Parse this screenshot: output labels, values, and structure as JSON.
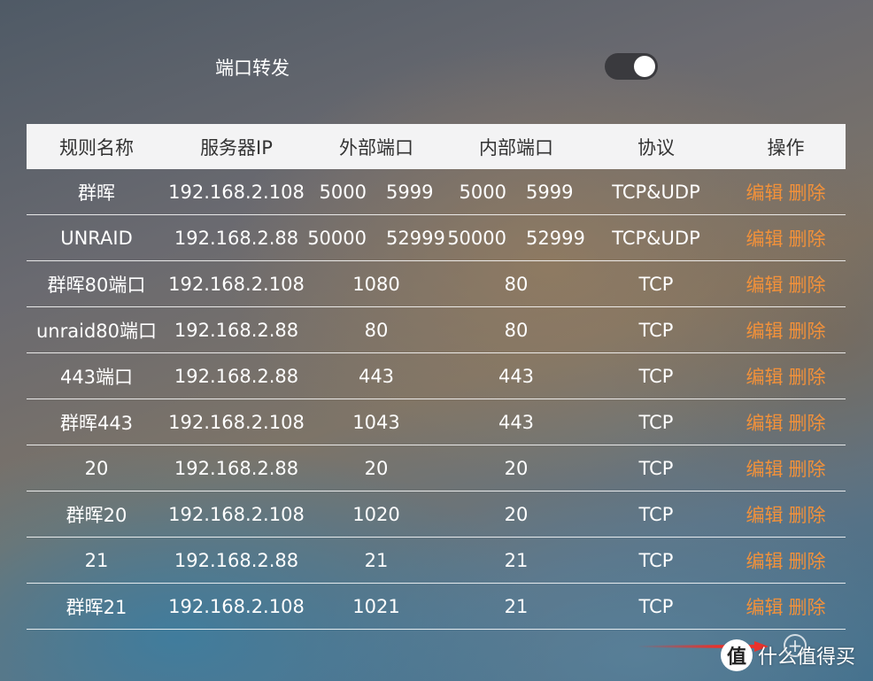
{
  "header": {
    "title": "端口转发",
    "toggle_on": true
  },
  "table": {
    "columns": [
      "规则名称",
      "服务器IP",
      "外部端口",
      "内部端口",
      "协议",
      "操作"
    ],
    "rows": [
      {
        "name": "群晖",
        "ip": "192.168.2.108",
        "ext_start": "5000",
        "ext_end": "5999",
        "int_start": "5000",
        "int_end": "5999",
        "proto": "TCP&UDP",
        "edit": "编辑",
        "delete": "删除"
      },
      {
        "name": "UNRAID",
        "ip": "192.168.2.88",
        "ext_start": "50000",
        "ext_end": "52999",
        "int_start": "50000",
        "int_end": "52999",
        "proto": "TCP&UDP",
        "edit": "编辑",
        "delete": "删除"
      },
      {
        "name": "群晖80端口",
        "ip": "192.168.2.108",
        "ext": "1080",
        "int": "80",
        "proto": "TCP",
        "edit": "编辑",
        "delete": "删除"
      },
      {
        "name": "unraid80端口",
        "ip": "192.168.2.88",
        "ext": "80",
        "int": "80",
        "proto": "TCP",
        "edit": "编辑",
        "delete": "删除"
      },
      {
        "name": "443端口",
        "ip": "192.168.2.88",
        "ext": "443",
        "int": "443",
        "proto": "TCP",
        "edit": "编辑",
        "delete": "删除"
      },
      {
        "name": "群晖443",
        "ip": "192.168.2.108",
        "ext": "1043",
        "int": "443",
        "proto": "TCP",
        "edit": "编辑",
        "delete": "删除"
      },
      {
        "name": "20",
        "ip": "192.168.2.88",
        "ext": "20",
        "int": "20",
        "proto": "TCP",
        "edit": "编辑",
        "delete": "删除"
      },
      {
        "name": "群晖20",
        "ip": "192.168.2.108",
        "ext": "1020",
        "int": "20",
        "proto": "TCP",
        "edit": "编辑",
        "delete": "删除"
      },
      {
        "name": "21",
        "ip": "192.168.2.88",
        "ext": "21",
        "int": "21",
        "proto": "TCP",
        "edit": "编辑",
        "delete": "删除"
      },
      {
        "name": "群晖21",
        "ip": "192.168.2.108",
        "ext": "1021",
        "int": "21",
        "proto": "TCP",
        "edit": "编辑",
        "delete": "删除"
      }
    ]
  },
  "actions": {
    "add_icon": "plus-circle-icon",
    "add_glyph": "+"
  },
  "watermark": {
    "badge": "值",
    "text": "什么值得买"
  },
  "colors": {
    "accent": "#f2913a",
    "toggle_track": "#3a3a3e",
    "header_bg": "#f3f3f4",
    "arrow": "#e8322c"
  }
}
